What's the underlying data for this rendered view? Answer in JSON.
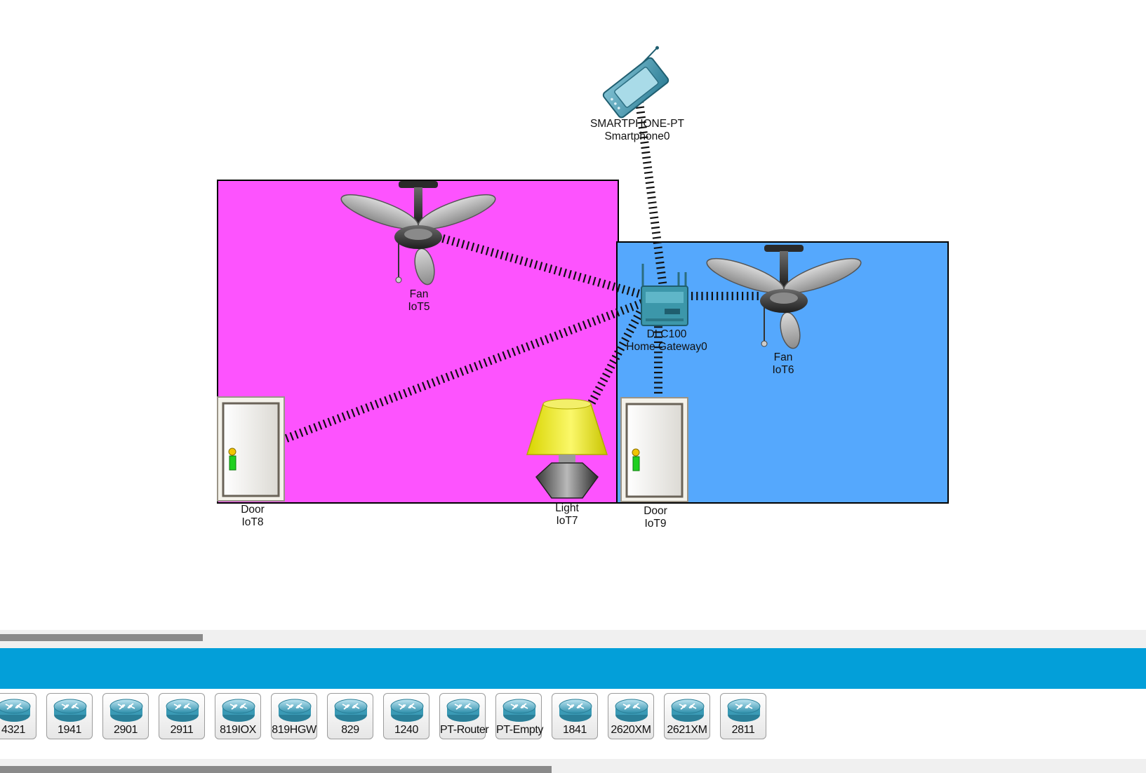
{
  "workspace": {
    "rooms": [
      {
        "name": "room-left",
        "color": "#fd53fe"
      },
      {
        "name": "room-right",
        "color": "#55a8fd"
      }
    ],
    "devices": {
      "smartphone": {
        "model": "SMARTPHONE-PT",
        "name": "Smartphone0",
        "icon": "smartphone-icon"
      },
      "gateway": {
        "model": "DLC100",
        "name": "Home Gateway0",
        "icon": "home-gateway-icon"
      },
      "fan_left": {
        "model": "Fan",
        "name": "IoT5",
        "icon": "ceiling-fan-icon"
      },
      "fan_right": {
        "model": "Fan",
        "name": "IoT6",
        "icon": "ceiling-fan-icon"
      },
      "door_left": {
        "model": "Door",
        "name": "IoT8",
        "icon": "door-icon"
      },
      "light": {
        "model": "Light",
        "name": "IoT7",
        "icon": "lamp-icon"
      },
      "door_right": {
        "model": "Door",
        "name": "IoT9",
        "icon": "door-icon"
      }
    }
  },
  "category_bar": {
    "color": "#039fd9"
  },
  "palette": {
    "items": [
      {
        "label": "4321",
        "icon": "router-icon"
      },
      {
        "label": "1941",
        "icon": "router-icon"
      },
      {
        "label": "2901",
        "icon": "router-icon"
      },
      {
        "label": "2911",
        "icon": "router-icon"
      },
      {
        "label": "819IOX",
        "icon": "router-icon"
      },
      {
        "label": "819HGW",
        "icon": "router-icon"
      },
      {
        "label": "829",
        "icon": "router-icon"
      },
      {
        "label": "1240",
        "icon": "router-icon"
      },
      {
        "label": "PT-Router",
        "icon": "router-icon"
      },
      {
        "label": "PT-Empty",
        "icon": "router-icon"
      },
      {
        "label": "1841",
        "icon": "router-icon"
      },
      {
        "label": "2620XM",
        "icon": "router-icon"
      },
      {
        "label": "2621XM",
        "icon": "router-icon"
      },
      {
        "label": "2811",
        "icon": "router-icon"
      }
    ]
  }
}
